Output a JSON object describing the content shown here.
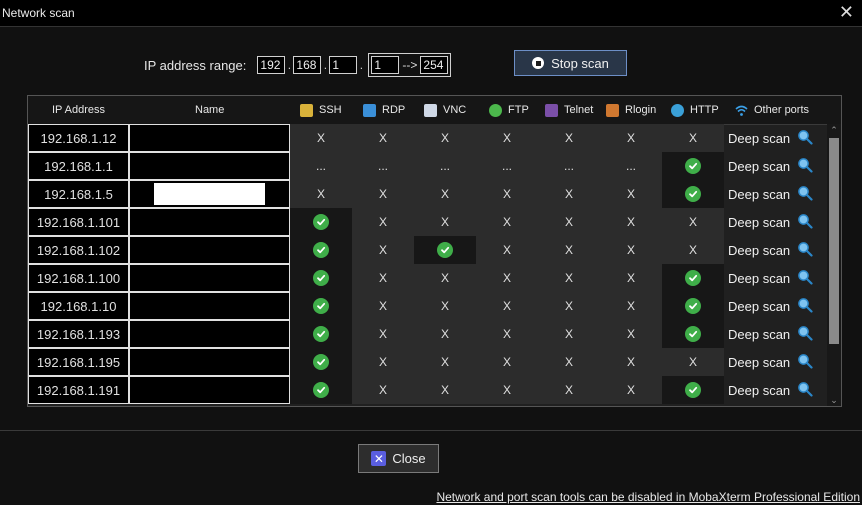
{
  "window": {
    "title": "Network scan",
    "close_glyph": "✕"
  },
  "range": {
    "label": "IP address range:",
    "octets": [
      "192",
      "168",
      "1"
    ],
    "start": "1",
    "arrow": "-->",
    "end": "254"
  },
  "stop_button": {
    "label": "Stop scan"
  },
  "table": {
    "columns": {
      "ip": "IP Address",
      "name": "Name",
      "ssh": "SSH",
      "rdp": "RDP",
      "vnc": "VNC",
      "ftp": "FTP",
      "telnet": "Telnet",
      "rlogin": "Rlogin",
      "http": "HTTP",
      "other": "Other ports"
    },
    "deep_scan_label": "Deep scan",
    "rows": [
      {
        "ip": "192.168.1.12",
        "name": "",
        "ports": [
          "X",
          "X",
          "X",
          "X",
          "X",
          "X",
          "X"
        ]
      },
      {
        "ip": "192.168.1.1",
        "name": "",
        "ports": [
          "...",
          "...",
          "...",
          "...",
          "...",
          "...",
          "ok"
        ]
      },
      {
        "ip": "192.168.1.5",
        "name": "",
        "ports": [
          "X",
          "X",
          "X",
          "X",
          "X",
          "X",
          "ok"
        ]
      },
      {
        "ip": "192.168.1.101",
        "name": "",
        "ports": [
          "ok",
          "X",
          "X",
          "X",
          "X",
          "X",
          "X"
        ]
      },
      {
        "ip": "192.168.1.102",
        "name": "",
        "ports": [
          "ok",
          "X",
          "ok",
          "X",
          "X",
          "X",
          "X"
        ]
      },
      {
        "ip": "192.168.1.100",
        "name": "",
        "ports": [
          "ok",
          "X",
          "X",
          "X",
          "X",
          "X",
          "ok"
        ]
      },
      {
        "ip": "192.168.1.10",
        "name": "",
        "ports": [
          "ok",
          "X",
          "X",
          "X",
          "X",
          "X",
          "ok"
        ]
      },
      {
        "ip": "192.168.1.193",
        "name": "",
        "ports": [
          "ok",
          "X",
          "X",
          "X",
          "X",
          "X",
          "ok"
        ]
      },
      {
        "ip": "192.168.1.195",
        "name": "",
        "ports": [
          "ok",
          "X",
          "X",
          "X",
          "X",
          "X",
          "X"
        ]
      },
      {
        "ip": "192.168.1.191",
        "name": "",
        "ports": [
          "ok",
          "X",
          "X",
          "X",
          "X",
          "X",
          "ok"
        ]
      }
    ]
  },
  "close_button": {
    "label": "Close"
  },
  "footer": {
    "link": "Network and port scan tools can be disabled in MobaXterm Professional Edition"
  },
  "colors": {
    "ok": "#3fae49",
    "accent_border": "#6d8fc7",
    "close_icon": "#5a5ee0"
  }
}
